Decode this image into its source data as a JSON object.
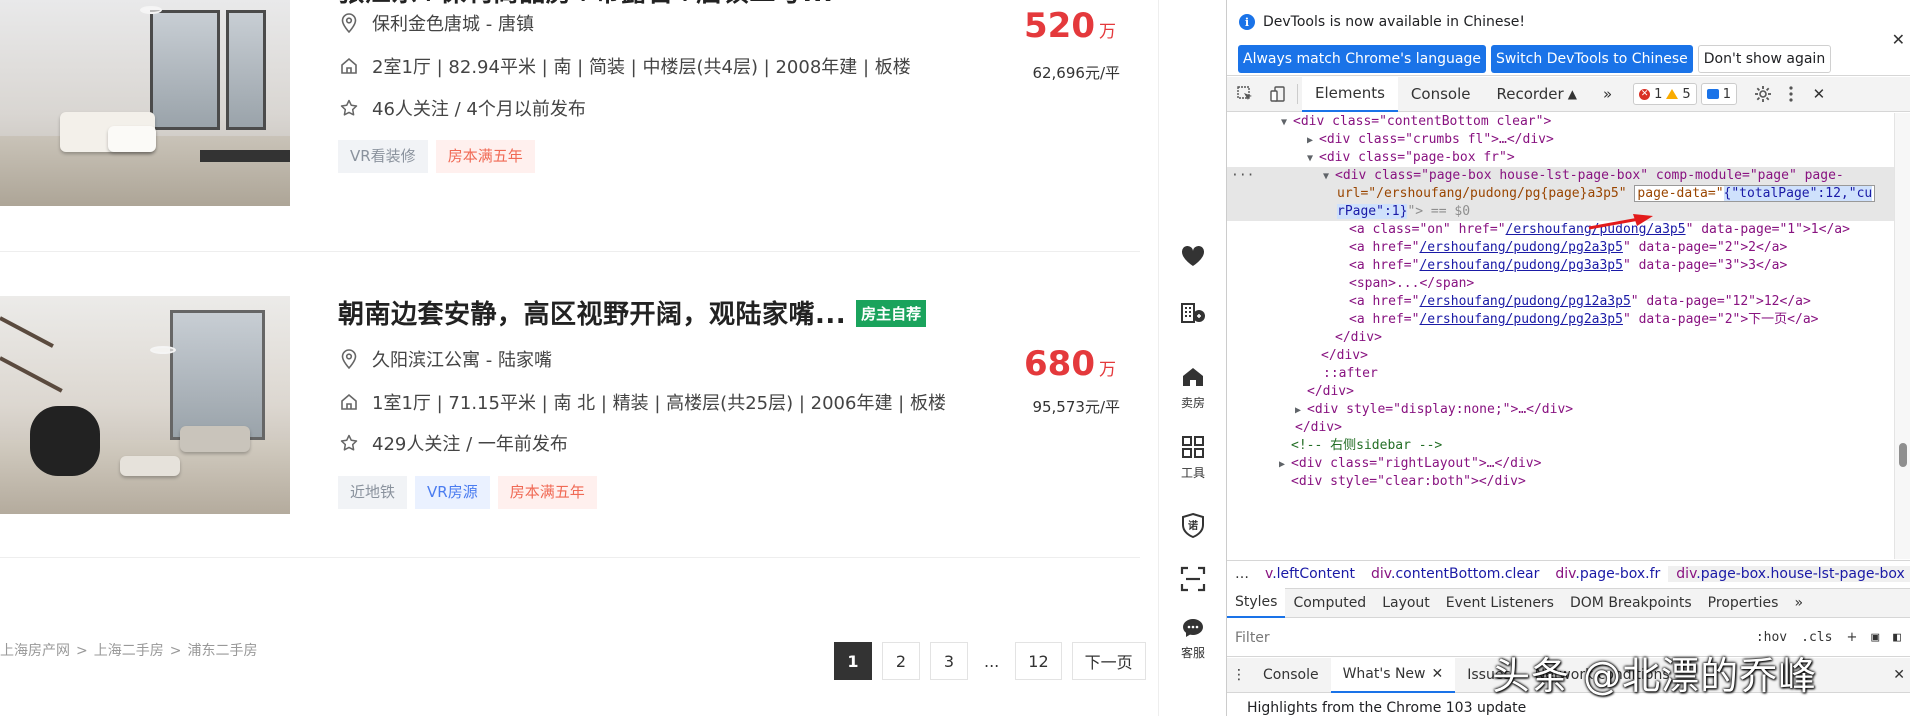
{
  "listings": [
    {
      "title": "张江东+保利商品房+带露台+唐镇二号...",
      "badge": "",
      "location": "保利金色唐城 - 唐镇",
      "info": "2室1厅 | 82.94平米 | 南 | 简装 | 中楼层(共4层) | 2008年建 | 板楼",
      "follow": "46人关注 / 4个月以前发布",
      "tags": [
        {
          "label": "VR看装修",
          "style": "gray"
        },
        {
          "label": "房本满五年",
          "style": "red"
        }
      ],
      "price": "520",
      "price_unit": "万",
      "unit_price": "62,696元/平"
    },
    {
      "title": "朝南边套安静，高区视野开阔，观陆家嘴...",
      "badge": "房主自荐",
      "location": "久阳滨江公寓 - 陆家嘴",
      "info": "1室1厅 | 71.15平米 | 南 北 | 精装 | 高楼层(共25层) | 2006年建 | 板楼",
      "follow": "429人关注 / 一年前发布",
      "tags": [
        {
          "label": "近地铁",
          "style": "gray"
        },
        {
          "label": "VR房源",
          "style": "blue"
        },
        {
          "label": "房本满五年",
          "style": "red"
        }
      ],
      "price": "680",
      "price_unit": "万",
      "unit_price": "95,573元/平"
    }
  ],
  "breadcrumb": [
    "上海房产网",
    "上海二手房",
    "浦东二手房"
  ],
  "pager": {
    "pages": [
      "1",
      "2",
      "3",
      "...",
      "12"
    ],
    "current": "1",
    "next": "下一页"
  },
  "toolbar": {
    "sell_label": "卖房",
    "tools_label": "工具",
    "service_label": "客服"
  },
  "devtools": {
    "notice": "DevTools is now available in Chinese!",
    "btn_match": "Always match Chrome's language",
    "btn_switch": "Switch DevTools to Chinese",
    "btn_dont": "Don't show again",
    "tabs": [
      "Elements",
      "Console",
      "Recorder",
      "»"
    ],
    "errors": "1",
    "warnings": "5",
    "messages": "1",
    "dom_lines": {
      "l0": "<div class=\"contentBottom clear\">",
      "l1": "<div class=\"crumbs fl\">…</div>",
      "l2": "<div class=\"page-box fr\">",
      "l3a": "<div class=\"page-box house-lst-page-box\" comp-module=\"page\" page-",
      "l3b_pre": "url=\"/ershoufang/pudong/pg{page}a3p5\"",
      "l3b_attr": "page-data=\"",
      "l3b_val": "{\"totalPage\":12,\"cu",
      "l3c_val": "rPage\":1}",
      "l3c_post": "\"> == $0",
      "a1": "<a class=\"on\" href=\"",
      "a1_href": "/ershoufang/pudong/a3p5",
      "a1_post": "\" data-page=\"1\">1</a>",
      "a2": "<a href=\"",
      "a2_href": "/ershoufang/pudong/pg2a3p5",
      "a2_post": "\" data-page=\"2\">2</a>",
      "a3": "<a href=\"",
      "a3_href": "/ershoufang/pudong/pg3a3p5",
      "a3_post": "\" data-page=\"3\">3</a>",
      "span": "<span>...</span>",
      "a12": "<a href=\"",
      "a12_href": "/ershoufang/pudong/pg12a3p5",
      "a12_post": "\" data-page=\"12\">12</a>",
      "anext": "<a href=\"",
      "anext_href": "/ershoufang/pudong/pg2a3p5",
      "anext_post": "\" data-page=\"2\">下一页</a>",
      "cdiv1": "</div>",
      "cdiv2": "</div>",
      "after": "::after",
      "cdiv3": "</div>",
      "hidden": "<div style=\"display:none;\">…</div>",
      "cdiv4": "</div>",
      "comment": "<!-- 右侧sidebar -->",
      "right": "<div class=\"rightLayout\">…</div>",
      "clear": "<div style=\"clear:both\"></div>"
    },
    "crumbs": [
      {
        "tag": "",
        "cls": ".leftContent",
        "prefix": "v"
      },
      {
        "tag": "div",
        "cls": ".contentBottom.clear",
        "prefix": ""
      },
      {
        "tag": "div",
        "cls": ".page-box.fr",
        "prefix": ""
      },
      {
        "tag": "div",
        "cls": ".page-box.house-lst-page-box",
        "prefix": ""
      }
    ],
    "subtabs": [
      "Styles",
      "Computed",
      "Layout",
      "Event Listeners",
      "DOM Breakpoints",
      "Properties",
      "»"
    ],
    "filter_placeholder": "Filter",
    "filter_hov": ":hov",
    "filter_cls": ".cls",
    "drawer_tabs": [
      "Console",
      "What's New",
      "Issues",
      "Network conditions"
    ],
    "highlights": "Highlights from the Chrome 103 update"
  },
  "watermark": "头条 @北漂的乔峰"
}
